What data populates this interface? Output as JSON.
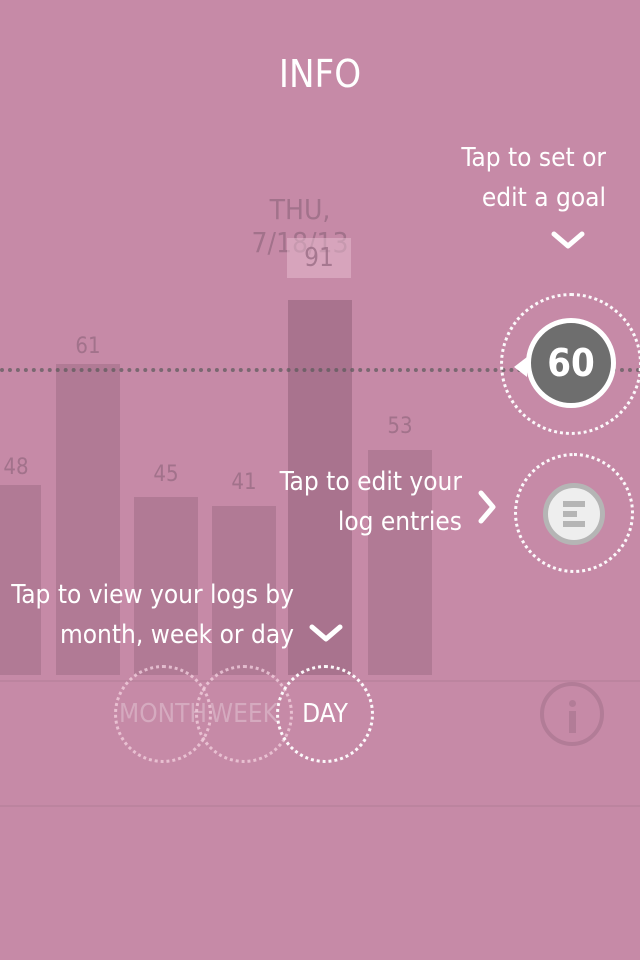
{
  "header": {
    "title": "INFO"
  },
  "chart": {
    "selected_date": "THU, 7/18/13",
    "selected_value": "91",
    "bars": [
      {
        "label": "48",
        "value": 48
      },
      {
        "label": "61",
        "value": 61
      },
      {
        "label": "45",
        "value": 45
      },
      {
        "label": "41",
        "value": 41
      },
      {
        "label": "91",
        "value": 91
      },
      {
        "label": "53",
        "value": 53
      }
    ],
    "goal_value": 60
  },
  "goal_button": {
    "label": "60"
  },
  "hints": {
    "goal_line1": "Tap to set or",
    "goal_line2": "edit a goal",
    "log_line1": "Tap to edit your",
    "log_line2": "log entries",
    "view_line1": "Tap to view your logs by",
    "view_line2": "month, week or day"
  },
  "view_tabs": {
    "month": "MONTH",
    "week": "WEEK",
    "day": "DAY"
  },
  "icons": {
    "goal_chevron": "chevron-down-icon",
    "log_chevron": "chevron-right-icon",
    "view_chevron": "chevron-down-icon",
    "log_entries": "log-entries-icon",
    "info": "info-icon"
  },
  "colors": {
    "background": "#c68aa7",
    "goal_badge": "#6e6e6e",
    "goal_dots": "#5a5a5a"
  }
}
